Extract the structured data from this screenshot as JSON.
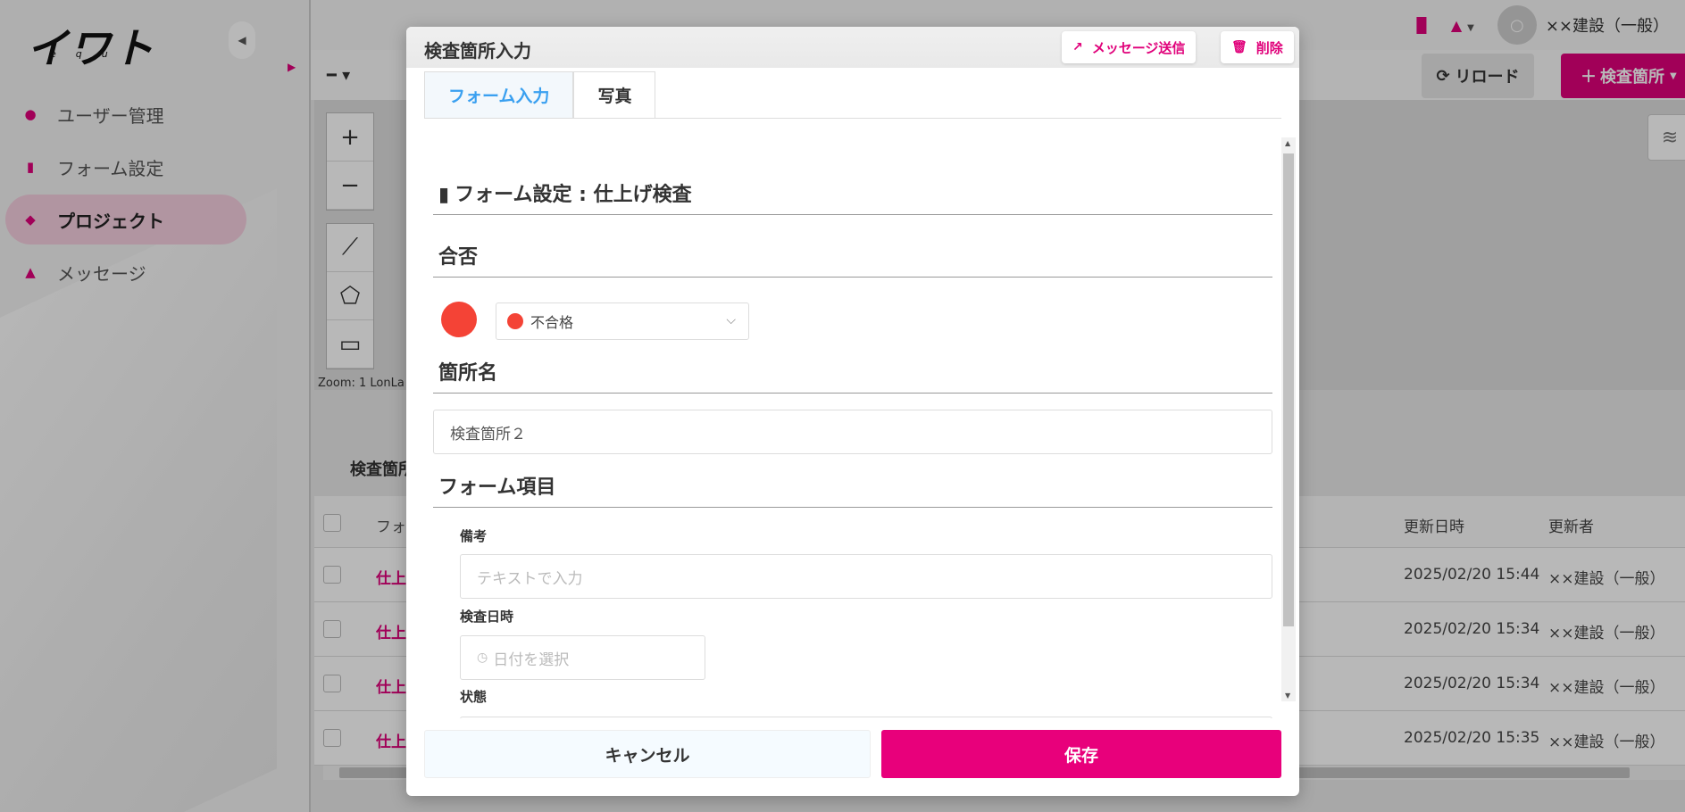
{
  "sidebar": {
    "logo_text": "イワト",
    "logo_sub": "equt",
    "items": [
      {
        "label": "ユーザー管理",
        "icon": "user-icon"
      },
      {
        "label": "フォーム設定",
        "icon": "clipboard-icon"
      },
      {
        "label": "プロジェクト",
        "icon": "cube-icon",
        "active": true
      },
      {
        "label": "メッセージ",
        "icon": "bell-icon"
      }
    ]
  },
  "header": {
    "user_name": "××建設（一般）"
  },
  "toolbar": {
    "reload_label": "リロード",
    "add_label": "検査箇所"
  },
  "map": {
    "zoom_text": "Zoom: 1 LonLa"
  },
  "table": {
    "title": "検査箇所",
    "headers": {
      "form": "フォ",
      "date": "更新日時",
      "user": "更新者"
    },
    "rows": [
      {
        "form": "仕上",
        "date": "2025/02/20 15:44",
        "user": "××建設（一般）"
      },
      {
        "form": "仕上",
        "date": "2025/02/20 15:34",
        "user": "××建設（一般）"
      },
      {
        "form": "仕上",
        "date": "2025/02/20 15:34",
        "user": "××建設（一般）"
      },
      {
        "form": "仕上",
        "date": "2025/02/20 15:35",
        "user": "××建設（一般）"
      }
    ]
  },
  "modal": {
    "title": "検査箇所入力",
    "send_message_label": "メッセージ送信",
    "delete_label": "削除",
    "tabs": [
      "フォーム入力",
      "写真"
    ],
    "form_setting_title": "フォーム設定 : 仕上げ検査",
    "pass_fail_title": "合否",
    "status_value": "不合格",
    "status_color": "#f44336",
    "location_name_title": "箇所名",
    "location_name_value": "検査箇所２",
    "form_items_title": "フォーム項目",
    "remarks_label": "備考",
    "remarks_placeholder": "テキストで入力",
    "inspection_date_label": "検査日時",
    "inspection_date_placeholder": "日付を選択",
    "state_label": "状態",
    "cancel_label": "キャンセル",
    "save_label": "保存"
  },
  "colors": {
    "accent": "#e0007a",
    "tab_active": "#3aa0f0",
    "fail": "#f44336"
  }
}
